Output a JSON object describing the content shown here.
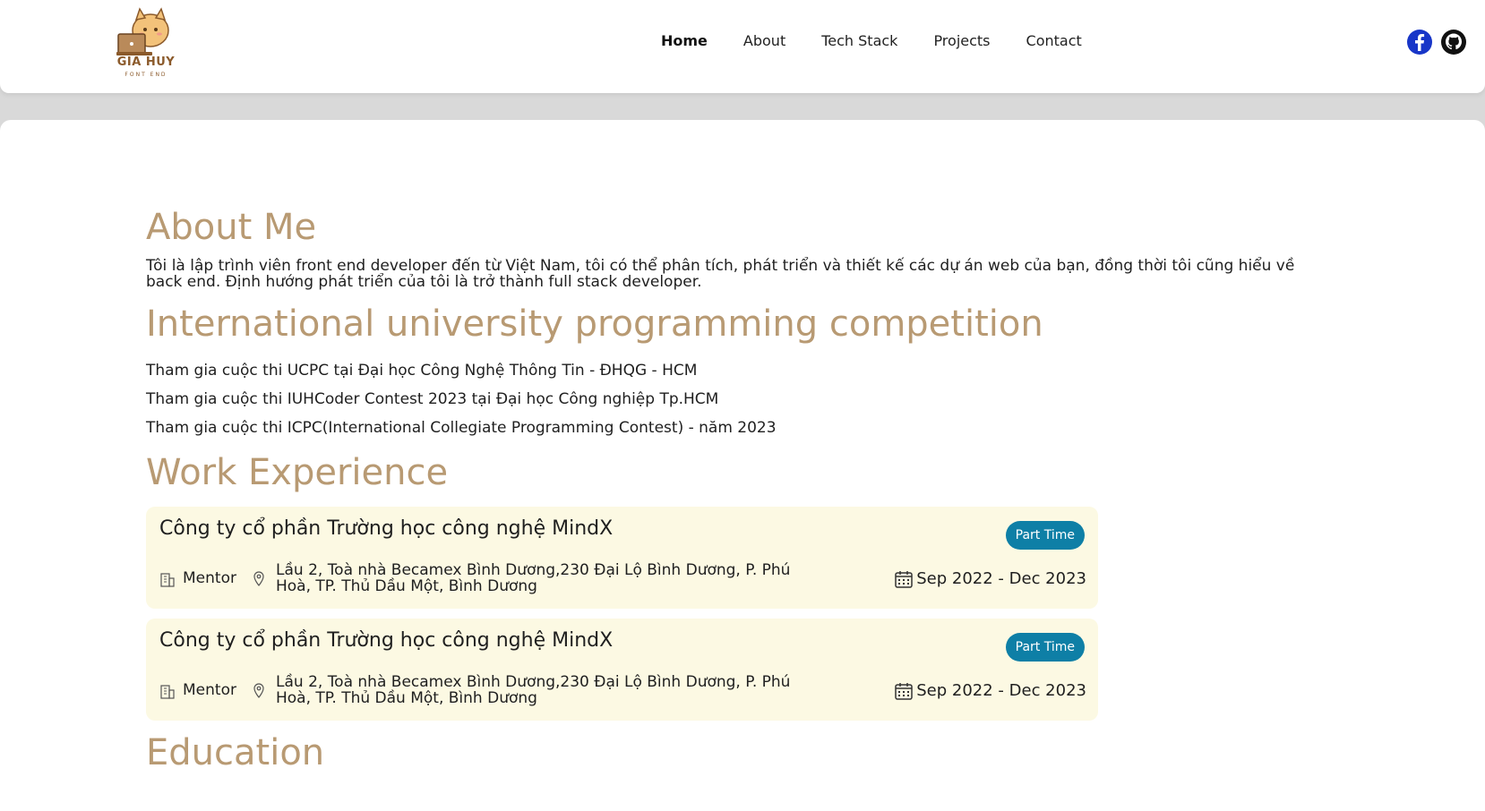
{
  "header": {
    "logo_text": "GIA HUY",
    "logo_subtext": "FONT END",
    "nav": [
      {
        "label": "Home",
        "active": true
      },
      {
        "label": "About",
        "active": false
      },
      {
        "label": "Tech Stack",
        "active": false
      },
      {
        "label": "Projects",
        "active": false
      },
      {
        "label": "Contact",
        "active": false
      }
    ],
    "social": [
      "facebook-icon",
      "github-icon"
    ]
  },
  "about": {
    "title": "About Me",
    "text": "Tôi là lập trình viên front end developer đến từ Việt Nam, tôi có thể phân tích, phát triển và thiết kế các dự án web của bạn, đồng thời tôi cũng hiểu về back end. Định hướng phát triển của tôi là trở thành full stack developer."
  },
  "competition": {
    "title": "International university programming competition",
    "items": [
      "Tham gia cuộc thi UCPC tại Đại học Công Nghệ Thông Tin - ĐHQG - HCM",
      "Tham gia cuộc thi IUHCoder Contest 2023 tại Đại học Công nghiệp Tp.HCM",
      "Tham gia cuộc thi ICPC(International Collegiate Programming Contest) - năm 2023"
    ]
  },
  "work": {
    "title": "Work Experience",
    "jobs": [
      {
        "company": "Công ty cổ phần Trường học công nghệ MindX",
        "type": "Part Time",
        "role": "Mentor",
        "address": "Lầu 2, Toà nhà Becamex Bình Dương,230 Đại Lộ Bình Dương, P. Phú Hoà, TP. Thủ Dầu Một, Bình Dương",
        "dates": "Sep 2022 - Dec 2023"
      },
      {
        "company": "Công ty cổ phần Trường học công nghệ MindX",
        "type": "Part Time",
        "role": "Mentor",
        "address": "Lầu 2, Toà nhà Becamex Bình Dương,230 Đại Lộ Bình Dương, P. Phú Hoà, TP. Thủ Dầu Một, Bình Dương",
        "dates": "Sep 2022 - Dec 2023"
      }
    ]
  },
  "education": {
    "title": "Education"
  },
  "colors": {
    "heading": "#b89a73",
    "card_bg": "#fcf9e3",
    "badge": "#0e7fa6",
    "facebook": "#1836c8"
  }
}
